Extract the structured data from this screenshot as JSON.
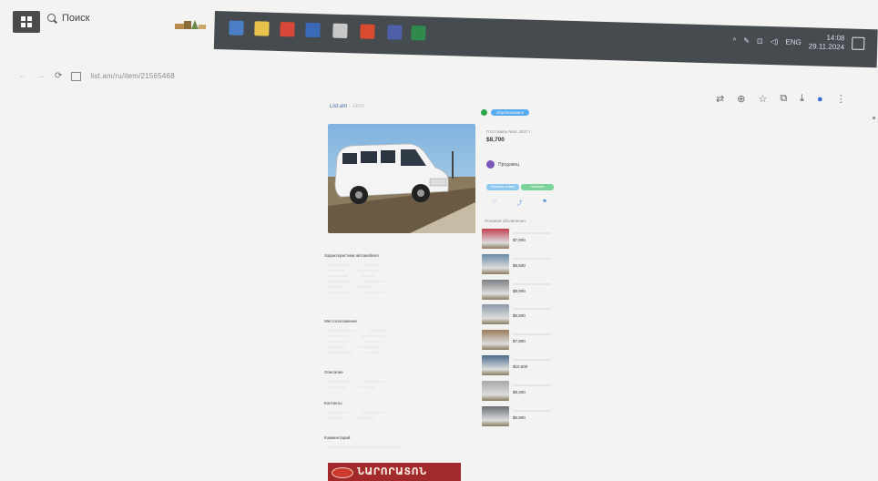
{
  "taskbar": {
    "search_label": "Поиск",
    "apps": [
      {
        "name": "explorer",
        "color": "#4c7fc8"
      },
      {
        "name": "files",
        "color": "#e8c14a"
      },
      {
        "name": "chrome",
        "color": "#d9463a"
      },
      {
        "name": "word",
        "color": "#3a69b8"
      },
      {
        "name": "media",
        "color": "#c8c8c8"
      },
      {
        "name": "pdf",
        "color": "#d84b2f"
      },
      {
        "name": "app",
        "color": "#4c5fa8"
      },
      {
        "name": "excel",
        "color": "#2f8a4c"
      }
    ],
    "tray_lang": "ENG",
    "tray_time": "14:08",
    "tray_date": "29.11.2024"
  },
  "browser": {
    "url": "list.am/ru/item/21565468",
    "icons": [
      "translate-icon",
      "zoom-icon",
      "bookmark-star-icon",
      "extensions-icon",
      "download-icon",
      "profile-icon",
      "menu-icon"
    ]
  },
  "page": {
    "breadcrumb": [
      "List.am",
      "›",
      "Авто"
    ],
    "status_badge": "Опубликовано",
    "listing_title": "ГАЗ Газель Next, 2017 г.",
    "price": "$8,700",
    "seller_name": "Продавец",
    "buttons": {
      "contact": "Показать номер",
      "message": "Написать"
    },
    "similar_title": "Похожие объявления",
    "similar": [
      {
        "price": "$7,000",
        "color": "#c04050"
      },
      {
        "price": "$9,500",
        "color": "#6a8aa8"
      },
      {
        "price": "$8,000",
        "color": "#7a7e82"
      },
      {
        "price": "$6,500",
        "color": "#8a9aa8"
      },
      {
        "price": "$7,800",
        "color": "#9a7a5a"
      },
      {
        "price": "$10,500",
        "color": "#4a6a8a"
      },
      {
        "price": "$8,200",
        "color": "#a8a8a8"
      },
      {
        "price": "$5,900",
        "color": "#6a6e74"
      }
    ],
    "sections": {
      "specs": "Характеристики автомобиля",
      "location": "Местоположение",
      "description": "Описание",
      "contacts": "Контакты",
      "comment": "Комментарий"
    },
    "banner_text": "ՆԱՐՈՐԱՏՈՆ"
  }
}
